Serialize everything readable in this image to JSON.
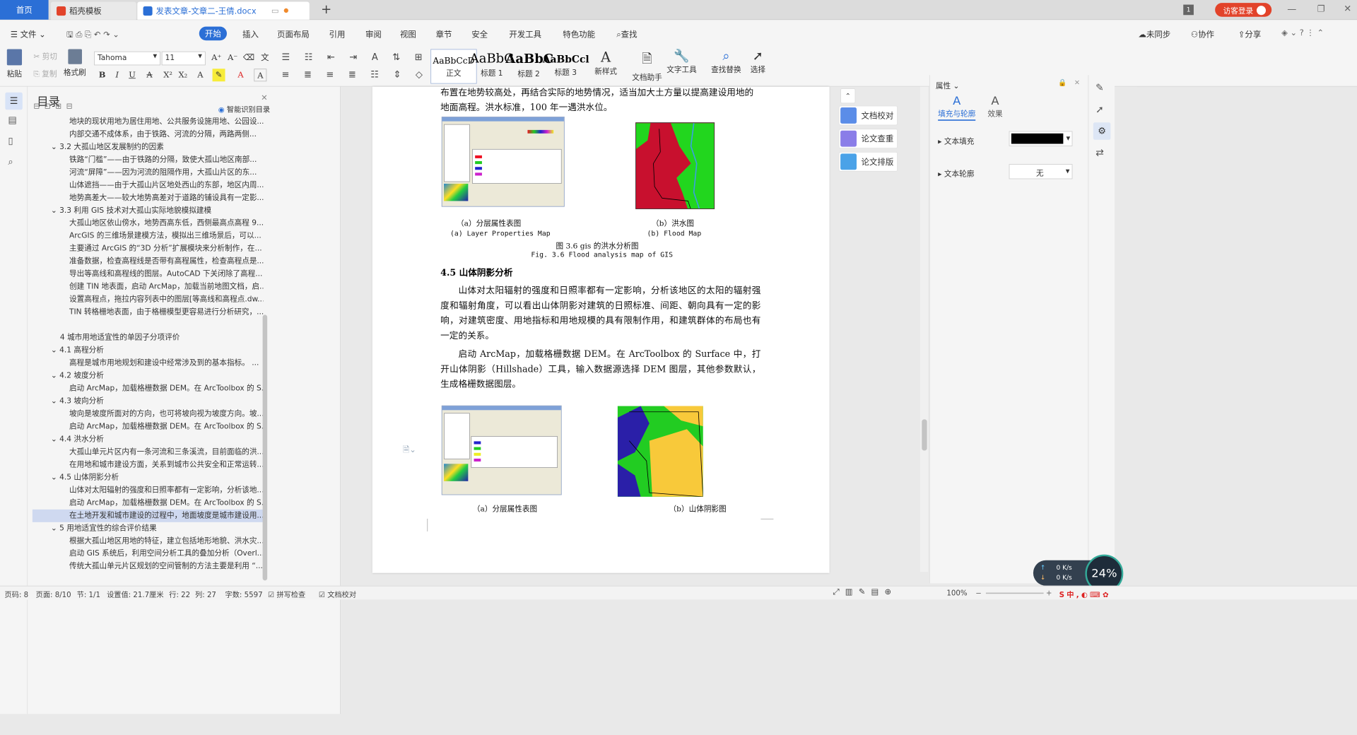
{
  "tabs": {
    "home": "首页",
    "template": "稻壳模板",
    "doc": "发表文章-文章二-王倩.docx"
  },
  "topright": {
    "badge": "1",
    "login": "访客登录"
  },
  "menu": {
    "file": "文件",
    "start": "开始",
    "insert": "插入",
    "layout": "页面布局",
    "ref": "引用",
    "review": "审阅",
    "view": "视图",
    "chapter": "章节",
    "security": "安全",
    "dev": "开发工具",
    "features": "特色功能",
    "search": "查找",
    "unsync": "未同步",
    "collab": "协作",
    "share": "分享"
  },
  "ribbon": {
    "paste": "粘贴",
    "cut": "剪切",
    "copy": "复制",
    "format_painter": "格式刷",
    "font": "Tahoma",
    "size": "11",
    "styles": [
      "正文",
      "标题 1",
      "标题 2",
      "标题 3"
    ],
    "styles_preview": [
      "AaBbCcD",
      "AaBbC",
      "AaBbC",
      "AaBbCcl"
    ],
    "newstyle": "新样式",
    "docassist": "文档助手",
    "texttools": "文字工具",
    "findreplace": "查找替换",
    "select": "选择"
  },
  "toc": {
    "title": "目录",
    "smart": "智能识别目录",
    "items": [
      {
        "level": 3,
        "text": "地块的现状用地为居住用地、公共服务设施用地、公园设..."
      },
      {
        "level": 3,
        "text": "内部交通不成体系，由于铁路、河流的分隔，两路两侧..."
      },
      {
        "level": 2,
        "text": "3.2 大孤山地区发展制约的因素"
      },
      {
        "level": 3,
        "text": "铁路“门槛”——由于铁路的分隔，致使大孤山地区南部..."
      },
      {
        "level": 3,
        "text": "河流“屏障”——因为河流的阻隔作用，大孤山片区的东..."
      },
      {
        "level": 3,
        "text": "山体遮挡——由于大孤山片区地处西山的东部，地区内周..."
      },
      {
        "level": 3,
        "text": "地势高差大——较大地势高差对于道路的铺设具有一定影..."
      },
      {
        "level": 2,
        "text": "3.3  利用 GIS 技术对大孤山实际地貌模拟建模"
      },
      {
        "level": 3,
        "text": "大孤山地区依山傍水，地势西高东低，西侧最高点高程 9..."
      },
      {
        "level": 3,
        "text": "ArcGIS 的三维场景建模方法，模拟出三维场景后，可以..."
      },
      {
        "level": 3,
        "text": "主要通过 ArcGIS 的“3D 分析”扩展模块来分析制作，在..."
      },
      {
        "level": 3,
        "text": "准备数据，检查高程线是否带有高程属性，检查高程点是..."
      },
      {
        "level": 3,
        "text": "导出等高线和高程线的图层。AutoCAD 下关闭除了高程..."
      },
      {
        "level": 3,
        "text": "创建 TIN 地表面，启动 ArcMap，加载当前地图文档，启..."
      },
      {
        "level": 3,
        "text": "设置高程点，拖拉内容列表中的图层[等高线和高程点.dw..."
      },
      {
        "level": 3,
        "text": "TIN 转格栅地表面，由于格栅模型更容易进行分析研究，..."
      },
      {
        "level": 0,
        "text": ""
      },
      {
        "level": 1,
        "text": "4  城市用地适宜性的单因子分项评价"
      },
      {
        "level": 2,
        "text": "4.1  高程分析"
      },
      {
        "level": 3,
        "text": "高程是城市用地规划和建设中经常涉及到的基本指标。   ..."
      },
      {
        "level": 2,
        "text": "4.2  坡度分析"
      },
      {
        "level": 3,
        "text": "启动 ArcMap，加载格栅数据 DEM。在 ArcToolbox 的 S..."
      },
      {
        "level": 2,
        "text": "4.3  坡向分析"
      },
      {
        "level": 3,
        "text": "坡向是坡度所面对的方向，也可将坡向视为坡度方向。坡..."
      },
      {
        "level": 3,
        "text": "启动 ArcMap，加载格栅数据 DEM。在 ArcToolbox 的 S..."
      },
      {
        "level": 2,
        "text": "4.4  洪水分析"
      },
      {
        "level": 3,
        "text": "大孤山单元片区内有一条河流和三条溪流，目前面临的洪..."
      },
      {
        "level": 3,
        "text": "在用地和城市建设方面，关系到城市公共安全和正常运转..."
      },
      {
        "level": 2,
        "text": "4.5  山体阴影分析"
      },
      {
        "level": 3,
        "text": "山体对太阳辐射的强度和日照率都有一定影响，分析该地..."
      },
      {
        "level": 3,
        "text": "启动 ArcMap，加载格栅数据 DEM。在 ArcToolbox 的 S..."
      },
      {
        "level": 3,
        "text": "在土地开发和城市建设的过程中，地面坡度是城市建设用..."
      },
      {
        "level": 2,
        "text": "5  用地适宜性的综合评价结果"
      },
      {
        "level": 3,
        "text": "根据大孤山地区用地的特征，建立包括地形地貌、洪水灾..."
      },
      {
        "level": 3,
        "text": "启动 GIS  系统后，利用空间分析工具的叠加分析（Overl..."
      },
      {
        "level": 3,
        "text": "传统大孤山单元片区规划的空间管制的方法主要是利用 “..."
      }
    ]
  },
  "doc": {
    "p0a": "布置在地势较高处，再结合实际的地势情况，适当加大土方量以提高建设用地的",
    "p0b": "地面高程。洪水标准，100 年一遇洪水位。",
    "cap_a1": "（a）分层属性表图",
    "cap_a1en": "(a) Layer Properties Map",
    "cap_b1": "（b）洪水图",
    "cap_b1en": "(b) Flood Map",
    "fig36": "图 3.6 gis 的洪水分析图",
    "fig36en": "Fig. 3.6 Flood analysis map of GIS",
    "h45": "4.5 山体阴影分析",
    "p1": "山体对太阳辐射的强度和日照率都有一定影响，分析该地区的太阳的辐射强度和辐射角度，可以看出山体阴影对建筑的日照标准、间距、朝向具有一定的影响，对建筑密度、用地指标和用地规模的具有限制作用，和建筑群体的布局也有一定的关系。",
    "p2": "启动 ArcMap，加载格栅数据 DEM。在 ArcToolbox 的 Surface 中，打开山体阴影（Hillshade）工具，输入数据源选择 DEM 图层，其他参数默认，生成格栅数据图层。",
    "cap_a2": "（a）分层属性表图",
    "cap_b2": "（b）山体阴影图"
  },
  "props": {
    "title": "属性",
    "tab1": "填充与轮廓",
    "tab2": "效果",
    "fill": "文本填充",
    "outline": "文本轮廓",
    "outline_val": "无"
  },
  "sidebtns": [
    "文档校对",
    "论文查重",
    "论文排版"
  ],
  "status": {
    "pages": "页码: 8",
    "page": "页面: 8/10",
    "section": "节: 1/1",
    "setting": "设置值: 21.7厘米",
    "row": "行: 22",
    "col": "列: 27",
    "words": "字数: 5597",
    "spell": "拼写检查",
    "proof": "文档校对",
    "zoom": "100%",
    "net_up": "0 K/s",
    "net_down": "0 K/s",
    "cpu": "24%"
  }
}
